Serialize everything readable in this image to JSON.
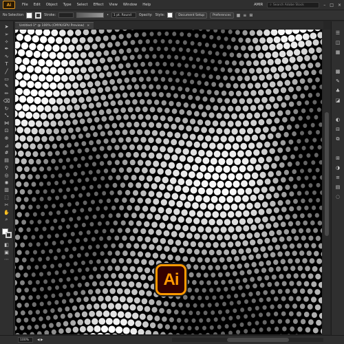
{
  "app": {
    "logo_text": "Ai",
    "user": "AMIR",
    "accent": "#ff9a00"
  },
  "menus": [
    "File",
    "Edit",
    "Object",
    "Type",
    "Select",
    "Effect",
    "View",
    "Window",
    "Help"
  ],
  "search": {
    "placeholder": "Search Adobe Stock"
  },
  "control": {
    "selection": "No Selection",
    "stroke_label": "Stroke:",
    "stroke_value": "",
    "profile_label": "1 pt. Round",
    "opacity_label": "Opacity:",
    "style_label": "Style:",
    "doc_setup": "Document Setup",
    "preferences": "Preferences"
  },
  "tab": {
    "title": "Untitled-1* @ 100% (CMYK/GPU Preview)",
    "close": "×"
  },
  "status": {
    "zoom": "100%"
  },
  "toolbar_icons": [
    "selection-arrow",
    "direct-selection",
    "magic-wand",
    "pen",
    "curvature",
    "type",
    "line",
    "rectangle",
    "paintbrush",
    "pencil",
    "eraser",
    "rotate",
    "scale",
    "width",
    "free-transform",
    "shape-builder",
    "perspective",
    "mesh",
    "gradient",
    "eyedropper",
    "blend",
    "symbol-sprayer",
    "column-graph",
    "artboard",
    "slice",
    "hand",
    "zoom"
  ],
  "panel_icons": [
    "properties",
    "layers",
    "libraries",
    "swatches",
    "brushes",
    "symbols",
    "graphic-styles",
    "appearance",
    "align",
    "pathfinder",
    "transform",
    "color"
  ],
  "artwork": {
    "description_colors": [
      "#000000",
      "#ffffff"
    ]
  }
}
